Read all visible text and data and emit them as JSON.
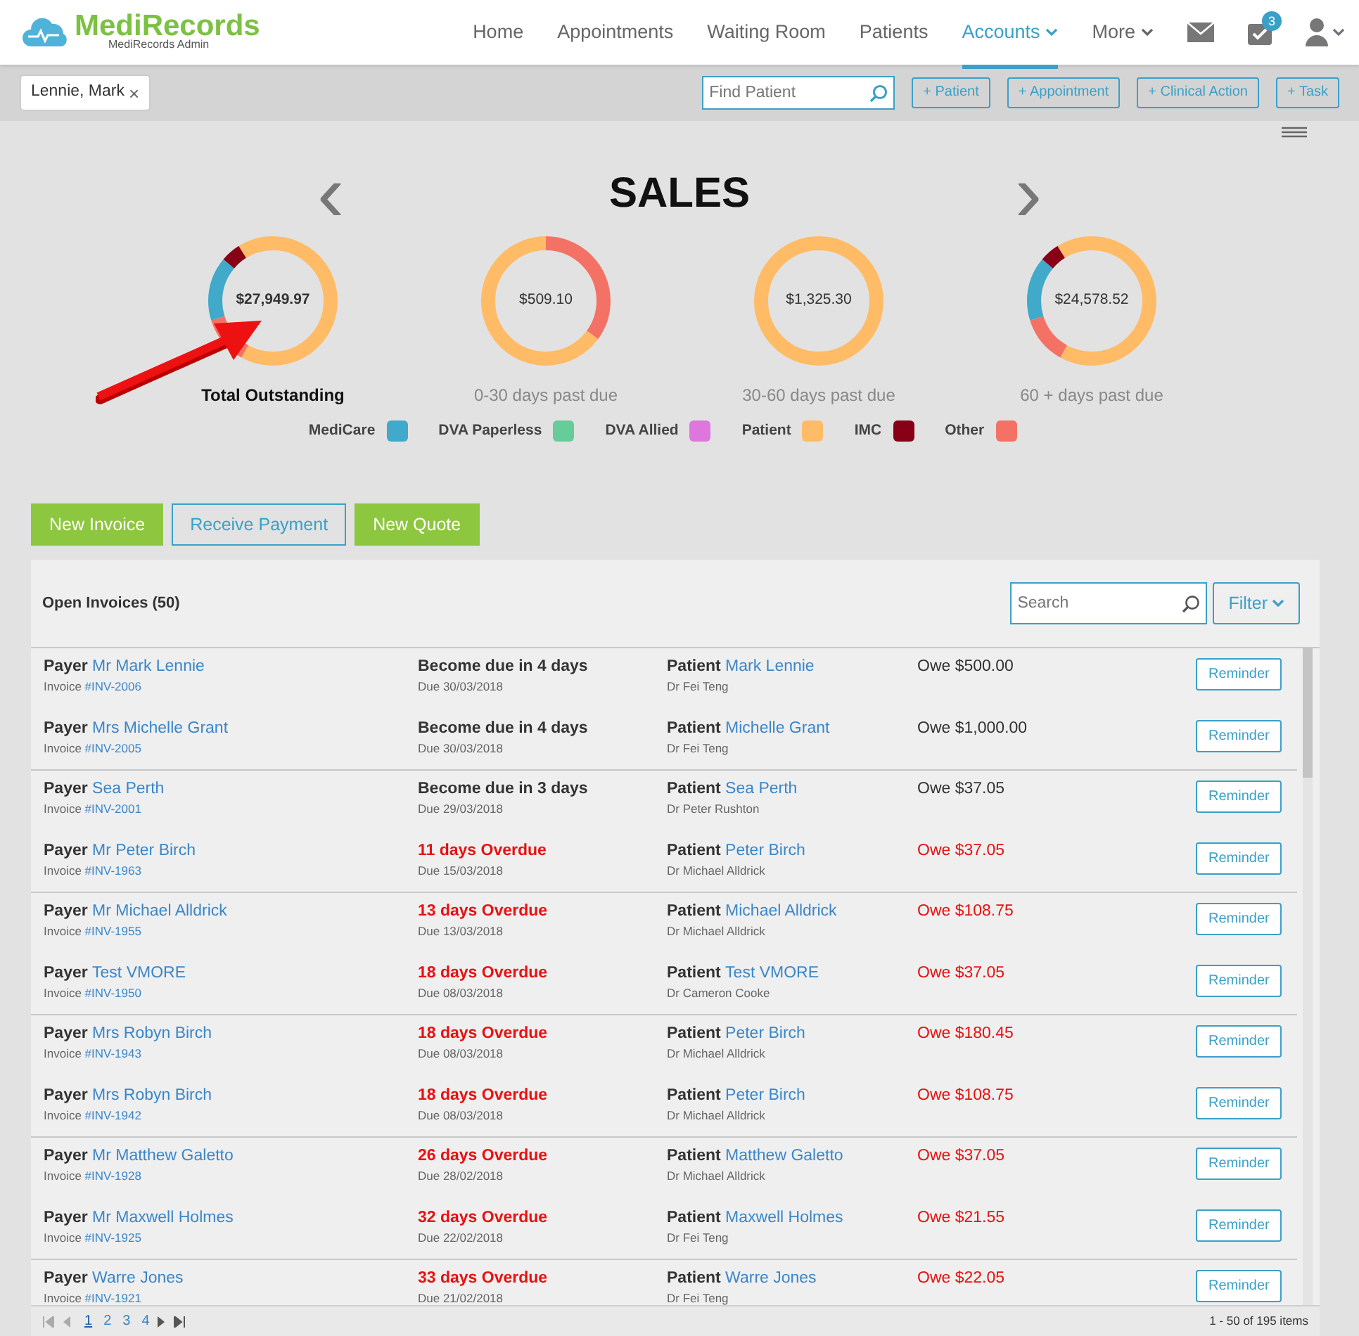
{
  "brand": {
    "name": "MediRecords",
    "subtitle": "MediRecords Admin"
  },
  "nav": [
    {
      "label": "Home",
      "selected": false,
      "dropdown": false
    },
    {
      "label": "Appointments",
      "selected": false,
      "dropdown": false
    },
    {
      "label": "Waiting Room",
      "selected": false,
      "dropdown": false
    },
    {
      "label": "Patients",
      "selected": false,
      "dropdown": false
    },
    {
      "label": "Accounts",
      "selected": true,
      "dropdown": true
    },
    {
      "label": "More",
      "selected": false,
      "dropdown": true
    }
  ],
  "task_badge": "3",
  "patient_tab": {
    "label": "Lennie, Mark",
    "close": "×"
  },
  "find_patient": {
    "placeholder": "Find Patient"
  },
  "toolbar_buttons": [
    "+ Patient",
    "+ Appointment",
    "+ Clinical Action",
    "+ Task"
  ],
  "sales": {
    "title": "SALES",
    "prev": "‹",
    "next": "›",
    "donuts": [
      {
        "amount": "$27,949.97",
        "label": "Total Outstanding",
        "selected": true
      },
      {
        "amount": "$509.10",
        "label": "0-30 days past due",
        "selected": false
      },
      {
        "amount": "$1,325.30",
        "label": "30-60 days past due",
        "selected": false
      },
      {
        "amount": "$24,578.52",
        "label": "60 + days past due",
        "selected": false
      }
    ],
    "legend": [
      {
        "label": "MediCare",
        "color": "#41a9c9"
      },
      {
        "label": "DVA Paperless",
        "color": "#66cc99"
      },
      {
        "label": "DVA Allied",
        "color": "#dd77dd"
      },
      {
        "label": "Patient",
        "color": "#ffbb66"
      },
      {
        "label": "IMC",
        "color": "#880015"
      },
      {
        "label": "Other",
        "color": "#f47265"
      }
    ]
  },
  "actions": [
    {
      "label": "New Invoice",
      "kind": "primary"
    },
    {
      "label": "Receive Payment",
      "kind": "outline"
    },
    {
      "label": "New Quote",
      "kind": "primary"
    }
  ],
  "invoices": {
    "title": "Open Invoices (50)",
    "search_placeholder": "Search",
    "filter": "Filter",
    "rows": [
      {
        "payer": "Mr Mark Lennie",
        "invoice": "#INV-2006",
        "status": "Become due in 4 days",
        "overdue": false,
        "due": "Due 30/03/2018",
        "patient": "Mark Lennie",
        "doctor": "Dr Fei Teng",
        "owe": "Owe $500.00",
        "button": "Reminder"
      },
      {
        "payer": "Mrs Michelle Grant",
        "invoice": "#INV-2005",
        "status": "Become due in 4 days",
        "overdue": false,
        "due": "Due 30/03/2018",
        "patient": "Michelle Grant",
        "doctor": "Dr Fei Teng",
        "owe": "Owe $1,000.00",
        "button": "Reminder"
      },
      {
        "payer": "Sea Perth",
        "invoice": "#INV-2001",
        "status": "Become due in 3 days",
        "overdue": false,
        "due": "Due 29/03/2018",
        "patient": "Sea Perth",
        "doctor": "Dr Peter Rushton",
        "owe": "Owe $37.05",
        "button": "Reminder"
      },
      {
        "payer": "Mr Peter Birch",
        "invoice": "#INV-1963",
        "status": "11 days Overdue",
        "overdue": true,
        "due": "Due 15/03/2018",
        "patient": "Peter Birch",
        "doctor": "Dr Michael Alldrick",
        "owe": "Owe $37.05",
        "button": "Reminder"
      },
      {
        "payer": "Mr Michael Alldrick",
        "invoice": "#INV-1955",
        "status": "13 days Overdue",
        "overdue": true,
        "due": "Due 13/03/2018",
        "patient": "Michael Alldrick",
        "doctor": "Dr Michael Alldrick",
        "owe": "Owe $108.75",
        "button": "Reminder"
      },
      {
        "payer": "Test VMORE",
        "invoice": "#INV-1950",
        "status": "18 days Overdue",
        "overdue": true,
        "due": "Due 08/03/2018",
        "patient": "Test VMORE",
        "doctor": "Dr Cameron Cooke",
        "owe": "Owe $37.05",
        "button": "Reminder"
      },
      {
        "payer": "Mrs Robyn Birch",
        "invoice": "#INV-1943",
        "status": "18 days Overdue",
        "overdue": true,
        "due": "Due 08/03/2018",
        "patient": "Peter Birch",
        "doctor": "Dr Michael Alldrick",
        "owe": "Owe $180.45",
        "button": "Reminder"
      },
      {
        "payer": "Mrs Robyn Birch",
        "invoice": "#INV-1942",
        "status": "18 days Overdue",
        "overdue": true,
        "due": "Due 08/03/2018",
        "patient": "Peter Birch",
        "doctor": "Dr Michael Alldrick",
        "owe": "Owe $108.75",
        "button": "Reminder"
      },
      {
        "payer": "Mr Matthew Galetto",
        "invoice": "#INV-1928",
        "status": "26 days Overdue",
        "overdue": true,
        "due": "Due 28/02/2018",
        "patient": "Matthew Galetto",
        "doctor": "Dr Michael Alldrick",
        "owe": "Owe $37.05",
        "button": "Reminder"
      },
      {
        "payer": "Mr Maxwell Holmes",
        "invoice": "#INV-1925",
        "status": "32 days Overdue",
        "overdue": true,
        "due": "Due 22/02/2018",
        "patient": "Maxwell Holmes",
        "doctor": "Dr Fei Teng",
        "owe": "Owe $21.55",
        "button": "Reminder"
      },
      {
        "payer": "Warre Jones",
        "invoice": "#INV-1921",
        "status": "33 days Overdue",
        "overdue": true,
        "due": "Due 21/02/2018",
        "patient": "Warre Jones",
        "doctor": "Dr Fei Teng",
        "owe": "Owe $22.05",
        "button": "Reminder"
      }
    ],
    "labels": [
      {
        "payer": "Payer",
        "invoice": "Invoice",
        "patient": "Patient"
      },
      {
        "payer": "Payer",
        "invoice": "Invoice",
        "patient": "Patient"
      },
      {
        "payer": "Payer",
        "invoice": "Invoice",
        "patient": "Patient"
      },
      {
        "payer": "Payer",
        "invoice": "Invoice",
        "patient": "Patient"
      },
      {
        "payer": "Payer",
        "invoice": "Invoice",
        "patient": "Patient"
      },
      {
        "payer": "Payer",
        "invoice": "Invoice",
        "patient": "Patient"
      },
      {
        "payer": "Payer",
        "invoice": "Invoice",
        "patient": "Patient"
      },
      {
        "payer": "Payer",
        "invoice": "Invoice",
        "patient": "Patient"
      },
      {
        "payer": "Payer",
        "invoice": "Invoice",
        "patient": "Patient"
      },
      {
        "payer": "Payer",
        "invoice": "Invoice",
        "patient": "Patient"
      },
      {
        "payer": "Payer",
        "invoice": "Invoice",
        "patient": "Patient"
      }
    ]
  },
  "pagination": {
    "pages": [
      {
        "label": "1",
        "selected": true
      },
      {
        "label": "2",
        "selected": false
      },
      {
        "label": "3",
        "selected": false
      },
      {
        "label": "4",
        "selected": false
      }
    ],
    "summary": "1 - 50 of 195 items"
  }
}
